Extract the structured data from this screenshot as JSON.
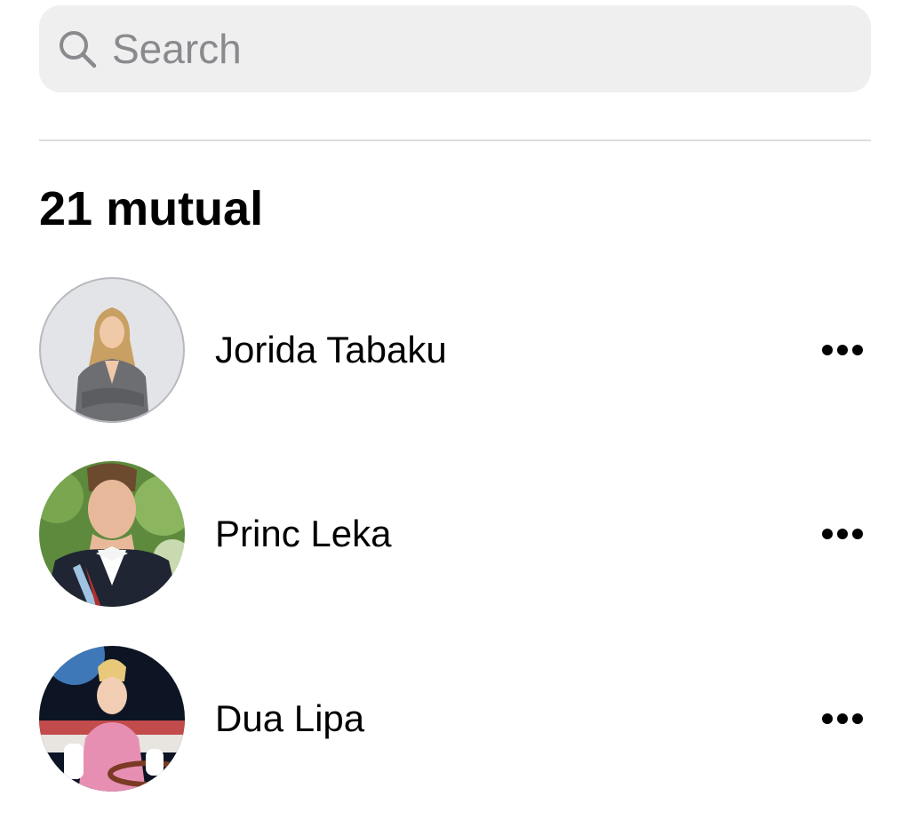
{
  "search": {
    "placeholder": "Search",
    "icon": "search-icon"
  },
  "section": {
    "title": "21 mutual"
  },
  "accounts": [
    {
      "name": "Jorida Tabaku",
      "avatar": "profile-photo-woman-gray-blazer",
      "menu_icon": "more-horizontal-icon"
    },
    {
      "name": "Princ Leka",
      "avatar": "profile-photo-man-suit-white-bowtie",
      "menu_icon": "more-horizontal-icon"
    },
    {
      "name": "Dua Lipa",
      "avatar": "profile-photo-woman-pink-outfit-car",
      "menu_icon": "more-horizontal-icon"
    }
  ],
  "colors": {
    "search_background": "#efefef",
    "placeholder": "#8a8a8e",
    "divider": "#dcdcdc",
    "text": "#000000"
  }
}
